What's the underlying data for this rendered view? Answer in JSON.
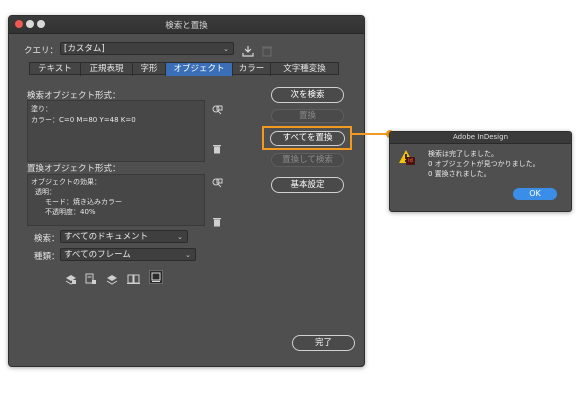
{
  "dialog": {
    "title": "検索と置換",
    "query_label": "クエリ：",
    "query_value": "[カスタム]",
    "tabs": [
      "テキスト",
      "正規表現",
      "字形",
      "オブジェクト",
      "カラー",
      "文字種変換"
    ],
    "active_tab": "オブジェクト",
    "find_section_label": "検索オブジェクト形式：",
    "find_lines": [
      "塗り：",
      "カラー：C=0 M=80 Y=48 K=0"
    ],
    "change_section_label": "置換オブジェクト形式：",
    "change_lines": [
      "オブジェクトの効果：",
      "透明：",
      "モード：焼き込みカラー",
      "不透明度：40%"
    ],
    "search_label": "検索：",
    "search_value": "すべてのドキュメント",
    "type_label": "種類：",
    "type_value": "すべてのフレーム",
    "buttons": {
      "find_next": "次を検索",
      "change": "置換",
      "change_all": "すべてを置換",
      "change_find": "置換して検索",
      "more_options": "基本設定",
      "done": "完了"
    },
    "highlight_color": "#f29a1f",
    "active_tab_color": "#3a6fb7"
  },
  "alert": {
    "title": "Adobe InDesign",
    "messages": [
      "検索は完了しました。",
      "0 オブジェクトが見つかりました。",
      "0 置換されました。"
    ],
    "ok_label": "OK",
    "ok_color": "#3b8ee8"
  }
}
